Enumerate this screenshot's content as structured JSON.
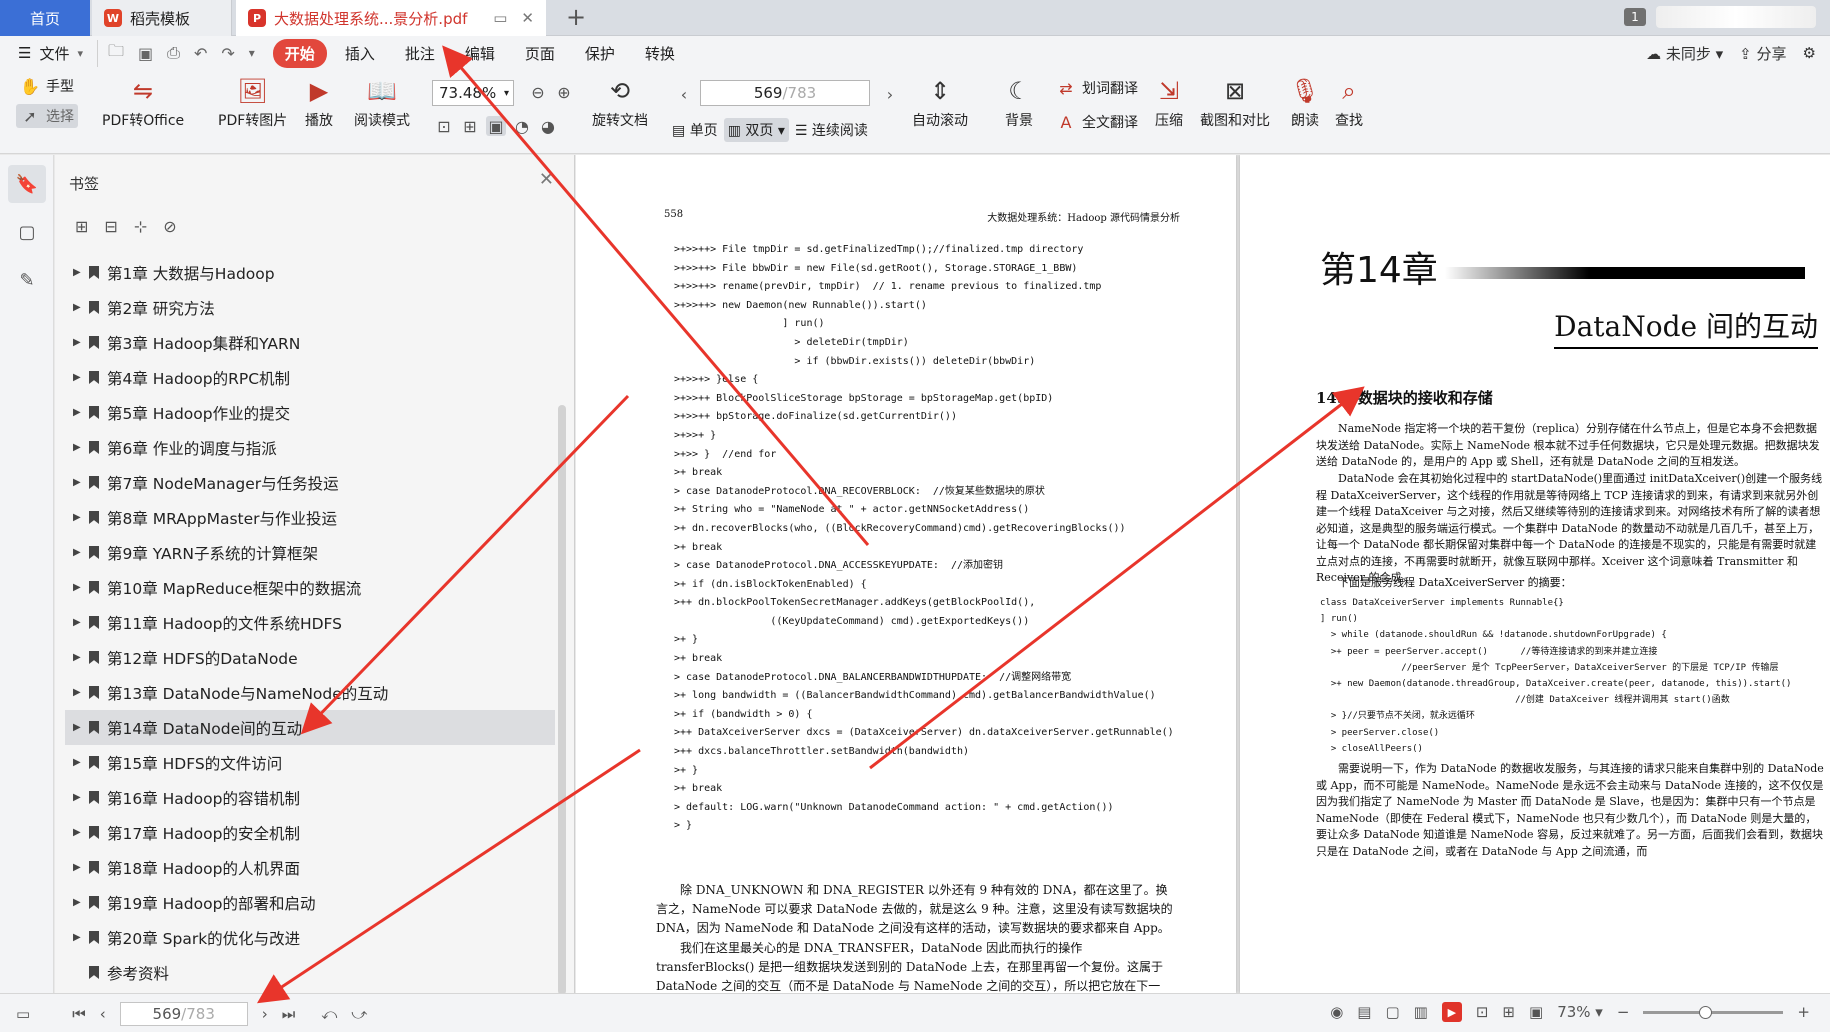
{
  "tabs": {
    "home": "首页",
    "docer": "稻壳模板",
    "doc": "大数据处理系统...景分析.pdf",
    "badge": "1"
  },
  "menu": {
    "file": "文件",
    "tabs": [
      "开始",
      "插入",
      "批注",
      "编辑",
      "页面",
      "保护",
      "转换"
    ],
    "sync": "未同步",
    "share": "分享"
  },
  "ribbon": {
    "hand": "手型",
    "select": "选择",
    "pdf_to_office": "PDF转Office",
    "pdf_to_image": "PDF转图片",
    "play": "播放",
    "read_mode": "阅读模式",
    "zoom": "73.48%",
    "rotate": "旋转文档",
    "page_current": "569",
    "page_total": "/783",
    "single": "单页",
    "double": "双页",
    "continuous": "连续阅读",
    "auto_scroll": "自动滚动",
    "background": "背景",
    "word_translate": "划词翻译",
    "full_translate": "全文翻译",
    "compress": "压缩",
    "screenshot_compare": "截图和对比",
    "read_aloud": "朗读",
    "find": "查找"
  },
  "panel": {
    "title": "书签",
    "bookmarks": [
      "第1章  大数据与Hadoop",
      "第2章  研究方法",
      "第3章  Hadoop集群和YARN",
      "第4章  Hadoop的RPC机制",
      "第5章  Hadoop作业的提交",
      "第6章  作业的调度与指派",
      "第7章  NodeManager与任务投运",
      "第8章  MRAppMaster与作业投运",
      "第9章  YARN子系统的计算框架",
      "第10章  MapReduce框架中的数据流",
      "第11章  Hadoop的文件系统HDFS",
      "第12章  HDFS的DataNode",
      "第13章  DataNode与NameNode的互动",
      "第14章  DataNode间的互动",
      "第15章  HDFS的文件访问",
      "第16章  Hadoop的容错机制",
      "第17章  Hadoop的安全机制",
      "第18章  Hadoop的人机界面",
      "第19章  Hadoop的部署和启动",
      "第20章  Spark的优化与改进",
      "参考资料"
    ],
    "selected_index": 13
  },
  "left_page": {
    "page_no": "558",
    "running_head": "大数据处理系统：Hadoop 源代码情景分析",
    "code": [
      ">+>>++> File tmpDir = sd.getFinalizedTmp();//finalized.tmp directory",
      ">+>>++> File bbwDir = new File(sd.getRoot(), Storage.STORAGE_1_BBW)",
      ">+>>++> rename(prevDir, tmpDir)  // 1. rename previous to finalized.tmp",
      ">+>>++> new Daemon(new Runnable()).start()",
      "                  ] run()",
      "                    > deleteDir(tmpDir)",
      "                    > if (bbwDir.exists()) deleteDir(bbwDir)",
      ">+>>+> }else {",
      ">+>>++ BlockPoolSliceStorage bpStorage = bpStorageMap.get(bpID)",
      ">+>>++ bpStorage.doFinalize(sd.getCurrentDir())",
      ">+>>+ }",
      ">+>> }  //end for",
      ">+ break",
      "> case DatanodeProtocol.DNA_RECOVERBLOCK:  //恢复某些数据块的原状",
      ">+ String who = \"NameNode at \" + actor.getNNSocketAddress()",
      ">+ dn.recoverBlocks(who, ((BlockRecoveryCommand)cmd).getRecoveringBlocks())",
      ">+ break",
      "> case DatanodeProtocol.DNA_ACCESSKEYUPDATE:  //添加密钥",
      ">+ if (dn.isBlockTokenEnabled) {",
      ">++ dn.blockPoolTokenSecretManager.addKeys(getBlockPoolId(),",
      "                ((KeyUpdateCommand) cmd).getExportedKeys())",
      ">+ }",
      ">+ break",
      "> case DatanodeProtocol.DNA_BALANCERBANDWIDTHUPDATE:  //调整网络带宽",
      ">+ long bandwidth = ((BalancerBandwidthCommand) cmd).getBalancerBandwidthValue()",
      ">+ if (bandwidth > 0) {",
      ">++ DataXceiverServer dxcs = (DataXceiverServer) dn.dataXceiverServer.getRunnable()",
      ">++ dxcs.balanceThrottler.setBandwidth(bandwidth)",
      ">+ }",
      ">+ break",
      "> default: LOG.warn(\"Unknown DatanodeCommand action: \" + cmd.getAction())",
      "> }"
    ],
    "para1": "除 DNA_UNKNOWN 和 DNA_REGISTER 以外还有 9 种有效的 DNA，都在这里了。换言之，NameNode 可以要求 DataNode 去做的，就是这么 9 种。注意，这里没有读写数据块的 DNA，因为 NameNode 和 DataNode 之间没有这样的活动，读写数据块的要求都来自 App。",
    "para2": "我们在这里最关心的是 DNA_TRANSFER，DataNode 因此而执行的操作 transferBlocks() 是把一组数据块发送到别的 DataNode 上去，在那里再留一个复份。这属于 DataNode 之间的交互（而不是 DataNode 与 NameNode 之间的交互），所以把它放在下一章。"
  },
  "right_page": {
    "chapter_num": "第14章",
    "chapter_title": "DataNode 间的互动",
    "section": "14.1  数据块的接收和存储",
    "para1": "NameNode 指定将一个块的若干复份（replica）分别存储在什么节点上，但是它本身不会把数据块发送给 DataNode。实际上 NameNode 根本就不过手任何数据块，它只是处理元数据。把数据块发送给 DataNode 的，是用户的 App 或 Shell，还有就是 DataNode 之间的互相发送。",
    "para2": "DataNode 会在其初始化过程中的 startDataNode()里面通过 initDataXceiver()创建一个服务线程 DataXceiverServer，这个线程的作用就是等待网络上 TCP 连接请求的到来，有请求到来就另外创建一个线程 DataXceiver 与之对接，然后又继续等待别的连接请求到来。对网络技术有所了解的读者想必知道，这是典型的服务端运行模式。一个集群中 DataNode 的数量动不动就是几百几千，甚至上万，让每一个 DataNode 都长期保留对集群中每一个 DataNode 的连接是不现实的，只能是有需要时就建立点对点的连接，不再需要时就断开，就像互联网中那样。Xceiver 这个词意味着 Transmitter 和 Receiver 的合成。",
    "para3": "下面是服务线程 DataXceiverServer 的摘要：",
    "code": [
      "class DataXceiverServer implements Runnable{}",
      "] run()",
      "  > while (datanode.shouldRun && !datanode.shutdownForUpgrade) {",
      "  >+ peer = peerServer.accept()      //等待连接请求的到来并建立连接",
      "               //peerServer 是个 TcpPeerServer，DataXceiverServer 的下层是 TCP/IP 传输层",
      "  >+ new Daemon(datanode.threadGroup, DataXceiver.create(peer, datanode, this)).start()",
      "                                    //创建 DataXceiver 线程并调用其 start()函数",
      "  > }//只要节点不关闭，就永远循环",
      "  > peerServer.close()",
      "  > closeAllPeers()"
    ],
    "para4": "需要说明一下，作为 DataNode 的数据收发服务，与其连接的请求只能来自集群中别的 DataNode 或 App，而不可能是 NameNode。NameNode 是永远不会主动来与 DataNode 连接的，这不仅仅是因为我们指定了 NameNode 为 Master 而 DataNode 是 Slave，也是因为：集群中只有一个节点是 NameNode（即使在 Federal 模式下，NameNode 也只有少数几个），而 DataNode 则是大量的，要让众多 DataNode 知道谁是 NameNode 容易，反过来就难了。另一方面，后面我们会看到，数据块只是在 DataNode 之间，或者在 DataNode 与 App 之间流通，而"
  },
  "status": {
    "page_current": "569",
    "page_total": "/783",
    "zoom": "73%"
  },
  "colors": {
    "accent_red": "#e2473c",
    "home_tab_blue": "#3b6fd6",
    "annotation_arrow": "#e8352b"
  }
}
